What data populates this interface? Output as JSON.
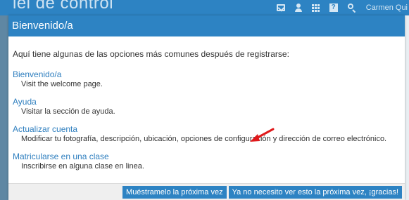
{
  "background": {
    "title": "iel de control",
    "user": "Carmen Qui"
  },
  "dialog": {
    "title": "Bienvenido/a",
    "intro": "Aquí tiene algunas de las opciones más comunes después de registrarse:",
    "options": [
      {
        "link": "Bienvenido/a",
        "description": "Visit the welcome page."
      },
      {
        "link": "Ayuda",
        "description": "Visitar la sección de ayuda."
      },
      {
        "link": "Actualizar cuenta",
        "description": "Modificar tu fotografía, descripción, ubicación, opciones de configuración y dirección de correo electrónico."
      },
      {
        "link": "Matricularse en una clase",
        "description": "Inscribirse en alguna clase en linea."
      }
    ],
    "buttons": {
      "remind": "Muéstramelo la próxima vez",
      "dismiss": "Ya no necesito ver esto la próxima vez, ¡gracias!"
    }
  },
  "colors": {
    "accent": "#2d83c3",
    "link": "#2f7fbf",
    "annotation_arrow": "#e0191b"
  },
  "icons": [
    "mail-icon",
    "user-icon",
    "grid-icon",
    "help-icon",
    "search-icon",
    "arrow-annotation-icon"
  ]
}
